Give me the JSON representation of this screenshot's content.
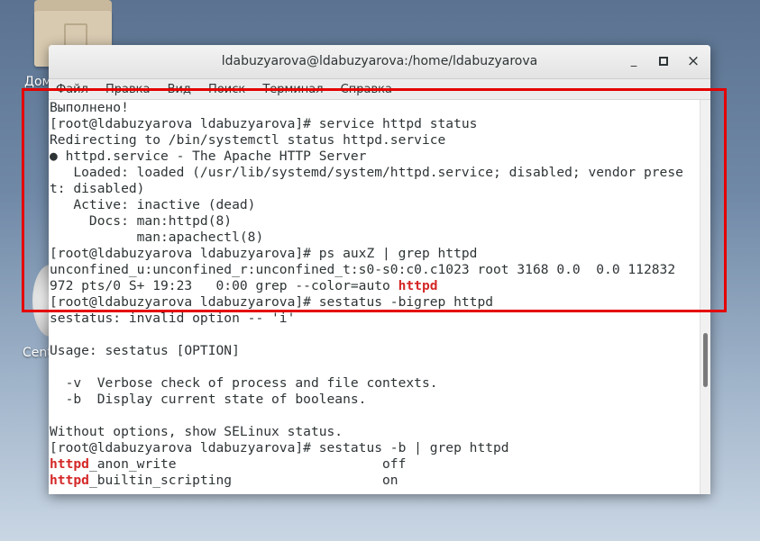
{
  "desktop": {
    "home_label": "Дом",
    "centos_label": "Cent"
  },
  "window": {
    "title": "ldabuzyarova@ldabuzyarova:/home/ldabuzyarova",
    "minimize": "_",
    "maximize": "▫",
    "close": "×"
  },
  "menubar": {
    "items": [
      "Файл",
      "Правка",
      "Вид",
      "Поиск",
      "Терминал",
      "Справка"
    ]
  },
  "terminal": {
    "lines": [
      [
        {
          "t": "Выполнено!"
        }
      ],
      [
        {
          "t": "[root@ldabuzyarova ldabuzyarova]# service httpd status"
        }
      ],
      [
        {
          "t": "Redirecting to /bin/systemctl status httpd.service"
        }
      ],
      [
        {
          "t": "● httpd.service - The Apache HTTP Server"
        }
      ],
      [
        {
          "t": "   Loaded: loaded (/usr/lib/systemd/system/httpd.service; disabled; vendor prese"
        }
      ],
      [
        {
          "t": "t: disabled)"
        }
      ],
      [
        {
          "t": "   Active: inactive (dead)"
        }
      ],
      [
        {
          "t": "     Docs: man:httpd(8)"
        }
      ],
      [
        {
          "t": "           man:apachectl(8)"
        }
      ],
      [
        {
          "t": "[root@ldabuzyarova ldabuzyarova]# ps auxZ | grep httpd"
        }
      ],
      [
        {
          "t": "unconfined_u:unconfined_r:unconfined_t:s0-s0:c0.c1023 root 3168 0.0  0.0 112832"
        }
      ],
      [
        {
          "t": "972 pts/0 S+ 19:23   0:00 grep --color=auto "
        },
        {
          "t": "httpd",
          "hl": true
        }
      ],
      [
        {
          "t": "[root@ldabuzyarova ldabuzyarova]# sestatus -bigrep httpd"
        }
      ],
      [
        {
          "t": "sestatus: invalid option -- 'i'"
        }
      ],
      [
        {
          "t": ""
        }
      ],
      [
        {
          "t": "Usage: sestatus [OPTION]"
        }
      ],
      [
        {
          "t": ""
        }
      ],
      [
        {
          "t": "  -v  Verbose check of process and file contexts."
        }
      ],
      [
        {
          "t": "  -b  Display current state of booleans."
        }
      ],
      [
        {
          "t": ""
        }
      ],
      [
        {
          "t": "Without options, show SELinux status."
        }
      ],
      [
        {
          "t": "[root@ldabuzyarova ldabuzyarova]# sestatus -b | grep httpd"
        }
      ],
      [
        {
          "t": "httpd",
          "hl": true
        },
        {
          "t": "_anon_write                          off"
        }
      ],
      [
        {
          "t": "httpd",
          "hl": true
        },
        {
          "t": "_builtin_scripting                   on"
        }
      ]
    ]
  },
  "colors": {
    "highlight_box": "#e50000",
    "grep_match": "#d42727"
  }
}
